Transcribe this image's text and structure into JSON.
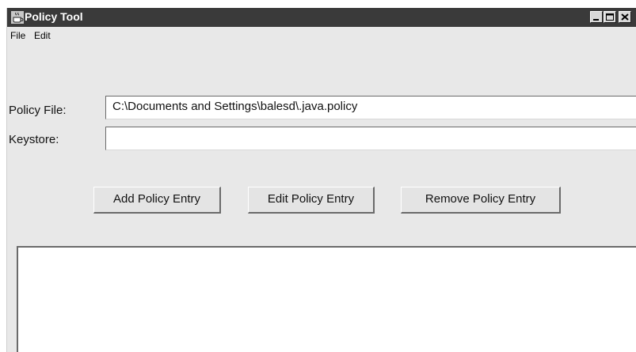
{
  "window": {
    "title": "Policy Tool",
    "app_icon": "java-cup-icon",
    "controls": {
      "minimize_icon": "minimize-icon",
      "maximize_icon": "maximize-icon",
      "close_icon": "close-icon"
    }
  },
  "menubar": {
    "items": [
      {
        "label": "File"
      },
      {
        "label": "Edit"
      }
    ]
  },
  "form": {
    "policy_file": {
      "label": "Policy File:",
      "value": "C:\\Documents and Settings\\balesd\\.java.policy"
    },
    "keystore": {
      "label": "Keystore:",
      "value": ""
    }
  },
  "buttons": {
    "add": "Add Policy Entry",
    "edit": "Edit Policy Entry",
    "remove": "Remove Policy Entry"
  },
  "policy_entries": []
}
